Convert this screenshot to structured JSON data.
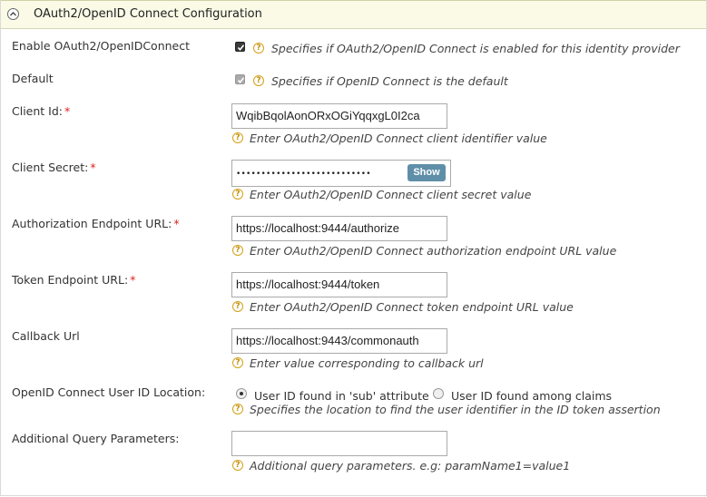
{
  "header": {
    "title": "OAuth2/OpenID Connect Configuration",
    "collapse_icon": "chevron-up-icon"
  },
  "fields": {
    "enable": {
      "label": "Enable OAuth2/OpenIDConnect",
      "hint": "Specifies if OAuth2/OpenID Connect is enabled for this identity provider",
      "checked": true
    },
    "default": {
      "label": "Default",
      "hint": "Specifies if OpenID Connect is the default",
      "checked": true,
      "disabled": true
    },
    "client_id": {
      "label": "Client Id:",
      "value": "WqibBqolAonORxOGiYqqxgL0I2ca",
      "hint": "Enter OAuth2/OpenID Connect client identifier value"
    },
    "client_secret": {
      "label": "Client Secret:",
      "value": "•••••••••••••••••••••••••••",
      "show_label": "Show",
      "hint": "Enter OAuth2/OpenID Connect client secret value"
    },
    "auth_endpoint": {
      "label": "Authorization Endpoint URL:",
      "value": "https://localhost:9444/authorize",
      "hint": "Enter OAuth2/OpenID Connect authorization endpoint URL value"
    },
    "token_endpoint": {
      "label": "Token Endpoint URL:",
      "value": "https://localhost:9444/token",
      "hint": "Enter OAuth2/OpenID Connect token endpoint URL value"
    },
    "callback": {
      "label": "Callback Url",
      "value": "https://localhost:9443/commonauth",
      "hint": "Enter value corresponding to callback url"
    },
    "user_id_location": {
      "label": "OpenID Connect User ID Location:",
      "options": [
        "User ID found in 'sub' attribute",
        "User ID found among claims"
      ],
      "selected": "User ID found in 'sub' attribute",
      "hint": "Specifies the location to find the user identifier in the ID token assertion"
    },
    "query_params": {
      "label": "Additional Query Parameters:",
      "value": "",
      "hint": "Additional query parameters. e.g: paramName1=value1"
    }
  },
  "required_marker": "*",
  "help_icon_glyph": "?",
  "colors": {
    "header_bg": "#fafae6",
    "required": "#e0201b",
    "help": "#d4a017",
    "show_button": "#5f8fa8"
  }
}
